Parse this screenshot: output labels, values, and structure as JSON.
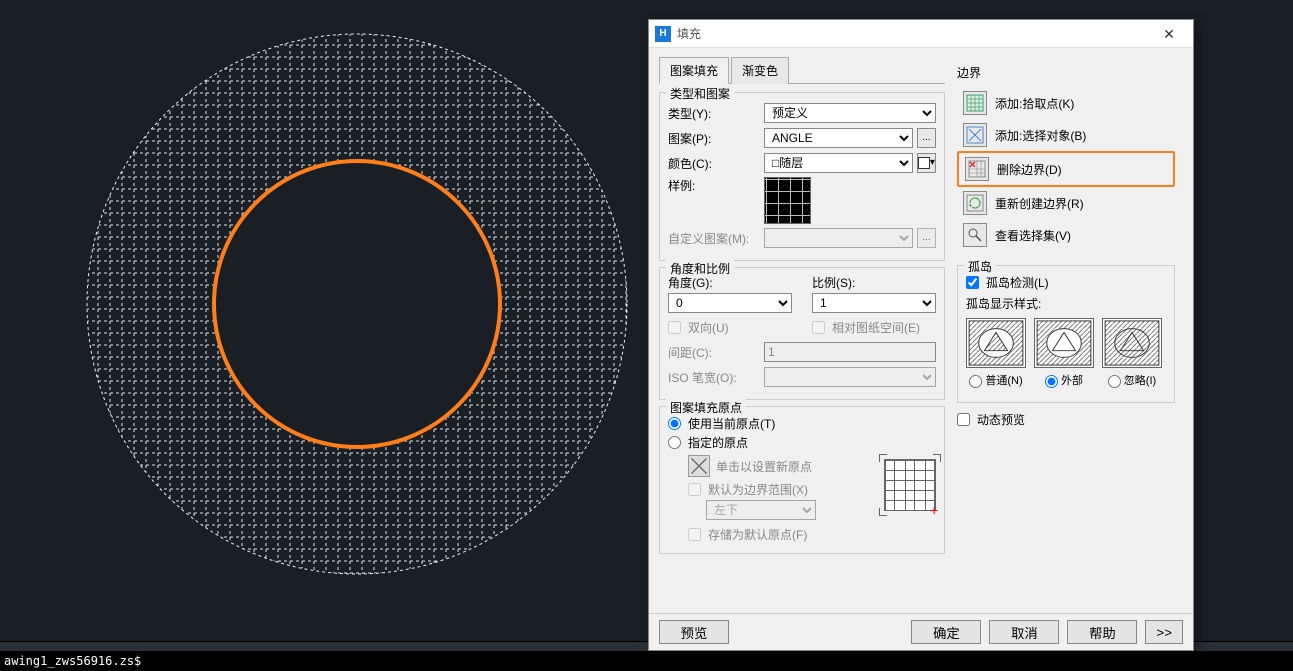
{
  "status_text": "awing1_zws56916.zs$",
  "dialog": {
    "title": "填充",
    "tabs": {
      "pattern": "图案填充",
      "gradient": "渐变色"
    },
    "type_pattern": {
      "group_title": "类型和图案",
      "type_label": "类型(Y):",
      "type_value": "预定义",
      "pattern_label": "图案(P):",
      "pattern_value": "ANGLE",
      "color_label": "颜色(C):",
      "color_value": "随层",
      "sample_label": "样例:",
      "custom_label": "自定义图案(M):"
    },
    "angle_scale": {
      "group_title": "角度和比例",
      "angle_label": "角度(G):",
      "angle_value": "0",
      "scale_label": "比例(S):",
      "scale_value": "1",
      "double_label": "双向(U)",
      "paperspace_label": "相对图纸空间(E)",
      "spacing_label": "间距(C):",
      "spacing_value": "1",
      "iso_label": "ISO 笔宽(O):"
    },
    "origin": {
      "group_title": "图案填充原点",
      "use_current": "使用当前原点(T)",
      "specified": "指定的原点",
      "click_set": "单击以设置新原点",
      "default_extents": "默认为边界范围(X)",
      "pos_value": "左下",
      "store_default": "存储为默认原点(F)"
    },
    "boundary": {
      "group_title": "边界",
      "add_pick": "添加:拾取点(K)",
      "add_select": "添加:选择对象(B)",
      "remove": "删除边界(D)",
      "recreate": "重新创建边界(R)",
      "view_sel": "查看选择集(V)"
    },
    "island": {
      "group_title": "孤岛",
      "detect_label": "孤岛检测(L)",
      "display_label": "孤岛显示样式:",
      "normal": "普通(N)",
      "outer": "外部",
      "ignore": "忽略(I)"
    },
    "dynamic_preview": "动态预览",
    "footer": {
      "preview": "预览",
      "ok": "确定",
      "cancel": "取消",
      "help": "帮助",
      "expand": ">>"
    }
  }
}
